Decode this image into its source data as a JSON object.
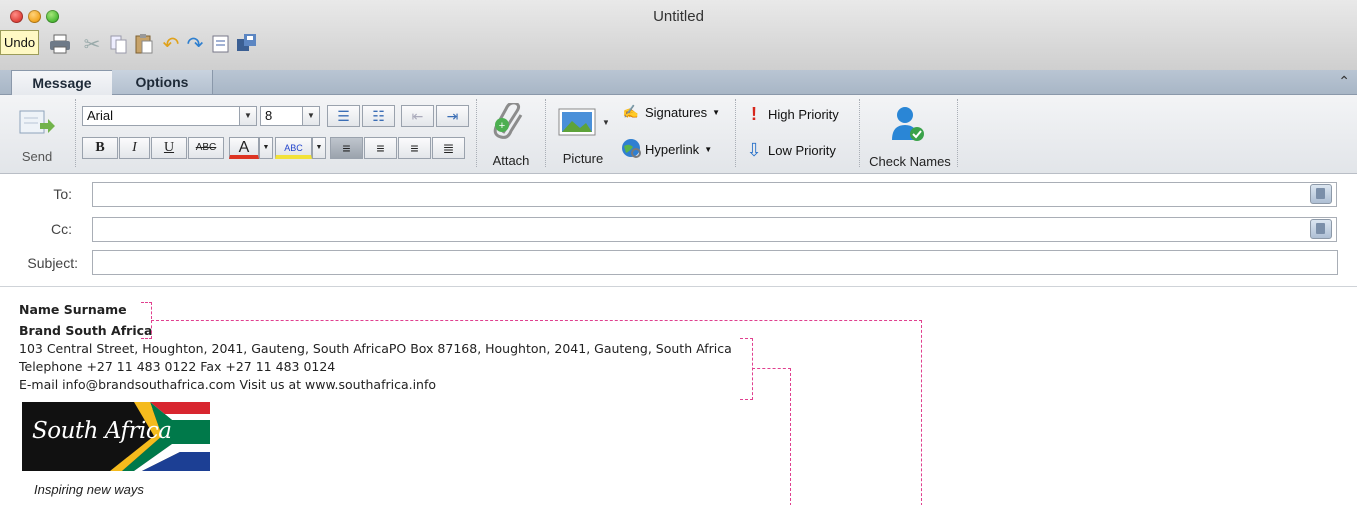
{
  "window": {
    "title": "Untitled"
  },
  "toolbar": {
    "tooltip": "Undo",
    "icons": [
      "print-icon",
      "cut-icon",
      "copy-icon",
      "paste-icon",
      "undo-icon",
      "redo-icon",
      "format-painter-icon",
      "save-icon"
    ]
  },
  "ribbon": {
    "tabs": [
      {
        "label": "Message"
      },
      {
        "label": "Options"
      }
    ],
    "send_label": "Send",
    "font_name": "Arial",
    "font_size": "8",
    "attach_label": "Attach",
    "picture_label": "Picture",
    "signatures_label": "Signatures",
    "hyperlink_label": "Hyperlink",
    "high_priority_label": "High Priority",
    "low_priority_label": "Low Priority",
    "check_names_label": "Check Names"
  },
  "header": {
    "to_label": "To:",
    "cc_label": "Cc:",
    "subject_label": "Subject:",
    "to_value": "",
    "cc_value": "",
    "subject_value": ""
  },
  "signature": {
    "name": "Name Surname",
    "org": "Brand South Africa",
    "address": "103 Central Street, Houghton, 2041, Gauteng, South AfricaPO Box 87168, Houghton, 2041, Gauteng, South Africa",
    "phone": "Telephone +27 11 483 0122 Fax +27 11 483 0124",
    "email": "E-mail info@brandsouthafrica.com Visit us at www.southafrica.info",
    "logo_text": "South Africa",
    "tagline": "Inspiring new ways"
  },
  "colors": {
    "annotation": "#e0408f",
    "ribbon_tab": "#a8b6c6"
  }
}
